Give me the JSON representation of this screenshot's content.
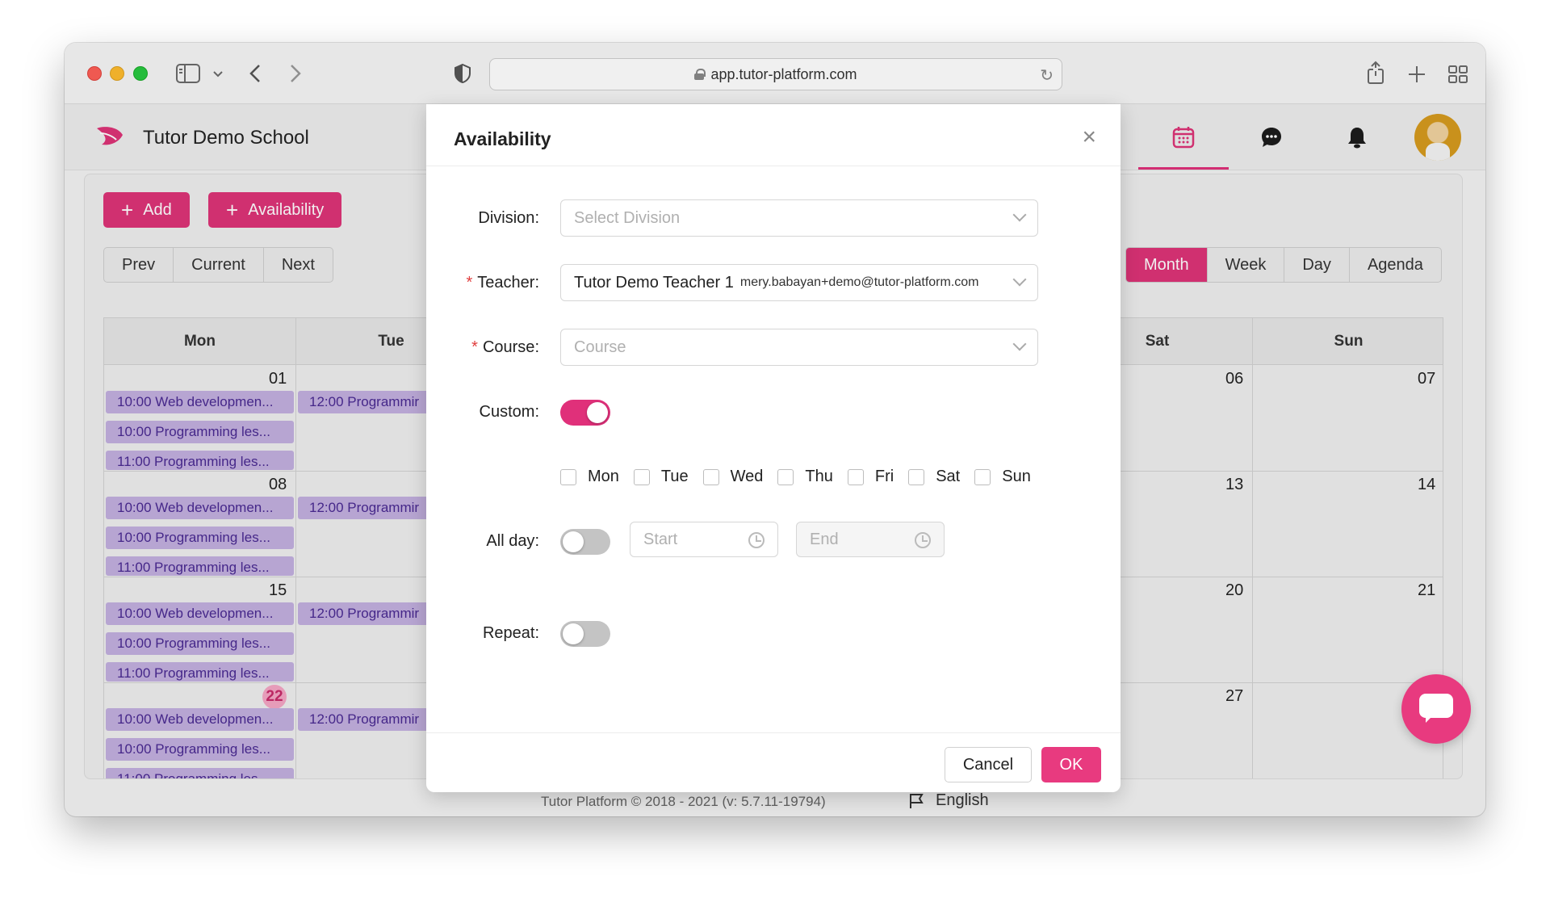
{
  "browser": {
    "url": "app.tutor-platform.com"
  },
  "app": {
    "school_name": "Tutor Demo School",
    "accent_color": "#dd3477",
    "nav_icons": [
      "calendar-icon",
      "chat-icon",
      "bell-icon"
    ]
  },
  "toolbar": {
    "add_label": "Add",
    "availability_label": "Availability",
    "prev_label": "Prev",
    "current_label": "Current",
    "next_label": "Next",
    "views": [
      "Month",
      "Week",
      "Day",
      "Agenda"
    ],
    "active_view": "Month"
  },
  "calendar": {
    "day_names": [
      "Mon",
      "Tue",
      "Sat",
      "Sun"
    ],
    "weeks": [
      {
        "mon": "01",
        "sat": "06",
        "sun": "07"
      },
      {
        "mon": "08",
        "sat": "13",
        "sun": "14"
      },
      {
        "mon": "15",
        "sat": "20",
        "sun": "21"
      },
      {
        "mon": "22",
        "sat": "27",
        "sun": ""
      }
    ],
    "events": {
      "mon_1": "10:00 Web developmen...",
      "mon_2": "10:00 Programming les...",
      "mon_3": "11:00 Programming les...",
      "mon_3_cut": "11:00 Programming les",
      "tue_1": "12:00 Programmir"
    }
  },
  "modal": {
    "title": "Availability",
    "division_label": "Division",
    "division_placeholder": "Select Division",
    "teacher_label": "Teacher",
    "teacher_value": "Tutor Demo Teacher 1",
    "teacher_email": "mery.babayan+demo@tutor-platform.com",
    "course_label": "Course",
    "course_placeholder": "Course",
    "custom_label": "Custom",
    "custom_on": true,
    "weekdays": [
      "Mon",
      "Tue",
      "Wed",
      "Thu",
      "Fri",
      "Sat",
      "Sun"
    ],
    "allday_label": "All day",
    "allday_on": false,
    "start_placeholder": "Start",
    "end_placeholder": "End",
    "repeat_label": "Repeat",
    "repeat_on": false,
    "cancel_label": "Cancel",
    "ok_label": "OK"
  },
  "footer": {
    "copyright": "Tutor Platform © 2018 - 2021 (v: 5.7.11-19794)",
    "language": "English"
  }
}
